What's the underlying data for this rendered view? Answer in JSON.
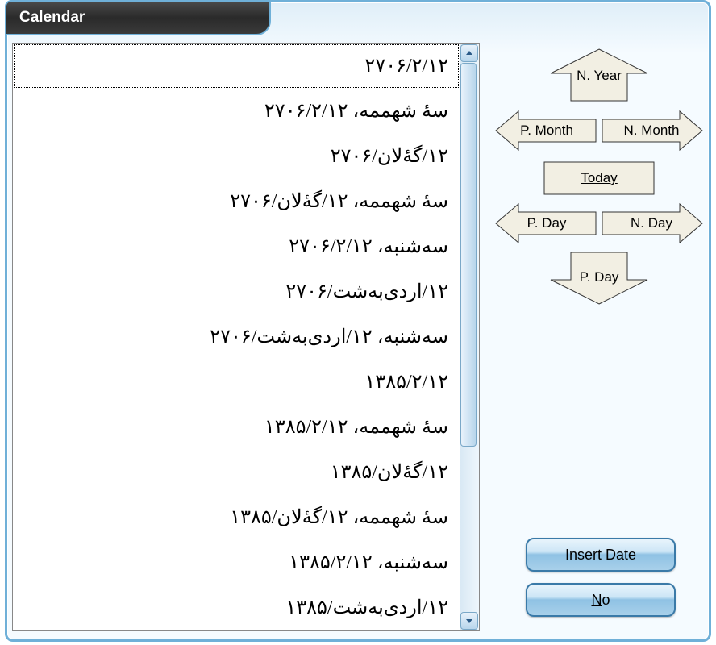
{
  "window": {
    "title": "Calendar"
  },
  "list": {
    "items": [
      "۲۷۰۶/۲/۱۲",
      "سۀ شهممه، ۲۷۰۶/۲/۱۲",
      "۱۲/گۀلان/۲۷۰۶",
      "سۀ شهممه، ۱۲/گۀلان/۲۷۰۶",
      "سه‌شنبه، ۲۷۰۶/۲/۱۲",
      "۱۲/اردی‌به‌شت/۲۷۰۶",
      "سه‌شنبه، ۱۲/اردی‌به‌شت/۲۷۰۶",
      "۱۳۸۵/۲/۱۲",
      "سۀ شهممه، ۱۳۸۵/۲/۱۲",
      "۱۲/گۀلان/۱۳۸۵",
      "سۀ شهممه، ۱۲/گۀلان/۱۳۸۵",
      "سه‌شنبه، ۱۳۸۵/۲/۱۲",
      "۱۲/اردی‌به‌شت/۱۳۸۵"
    ],
    "selected_index": 0
  },
  "nav": {
    "n_year": "N. Year",
    "p_month": "P. Month",
    "n_month": "N. Month",
    "today": "Today",
    "p_day": "P. Day",
    "n_day": "N. Day",
    "p_day2": "P. Day"
  },
  "actions": {
    "insert": "Insert Date",
    "no_prefix": "N",
    "no_suffix": "o"
  },
  "colors": {
    "arrow_fill": "#f2efe3",
    "arrow_stroke": "#333"
  }
}
